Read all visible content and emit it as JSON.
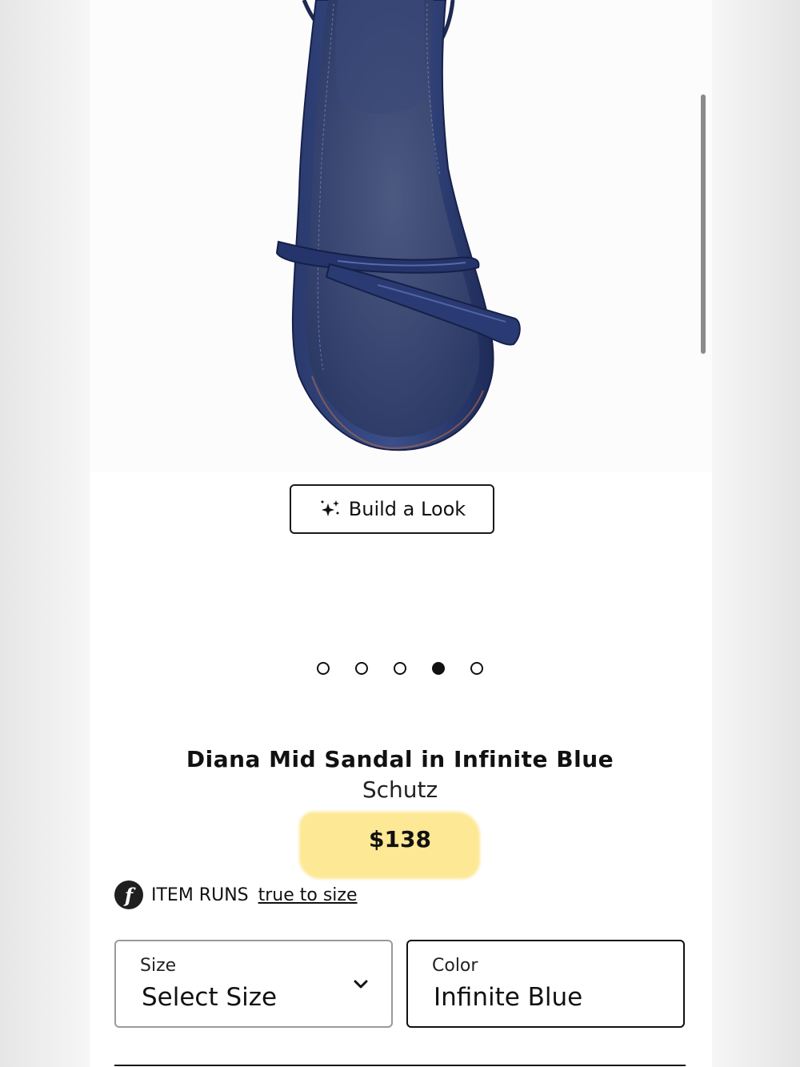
{
  "gallery": {
    "image_alt": "Diana Mid Sandal in Infinite Blue top view",
    "dots_total": 5,
    "active_dot": 4
  },
  "build_look": {
    "label": "Build a Look",
    "icon": "sparkle-icon"
  },
  "product": {
    "name": "Diana Mid Sandal in Infinite Blue",
    "brand": "Schutz",
    "price": "$138"
  },
  "fit": {
    "logo_letter": "f",
    "prefix": "ITEM RUNS",
    "link": "true to size"
  },
  "size_select": {
    "label": "Size",
    "value": "Select Size",
    "icon": "chevron-down-icon"
  },
  "color_select": {
    "label": "Color",
    "value": "Infinite Blue"
  },
  "colors": {
    "sandal_navy": "#1f2f5f",
    "price_highlight": "#fde68a",
    "text": "#111111"
  }
}
